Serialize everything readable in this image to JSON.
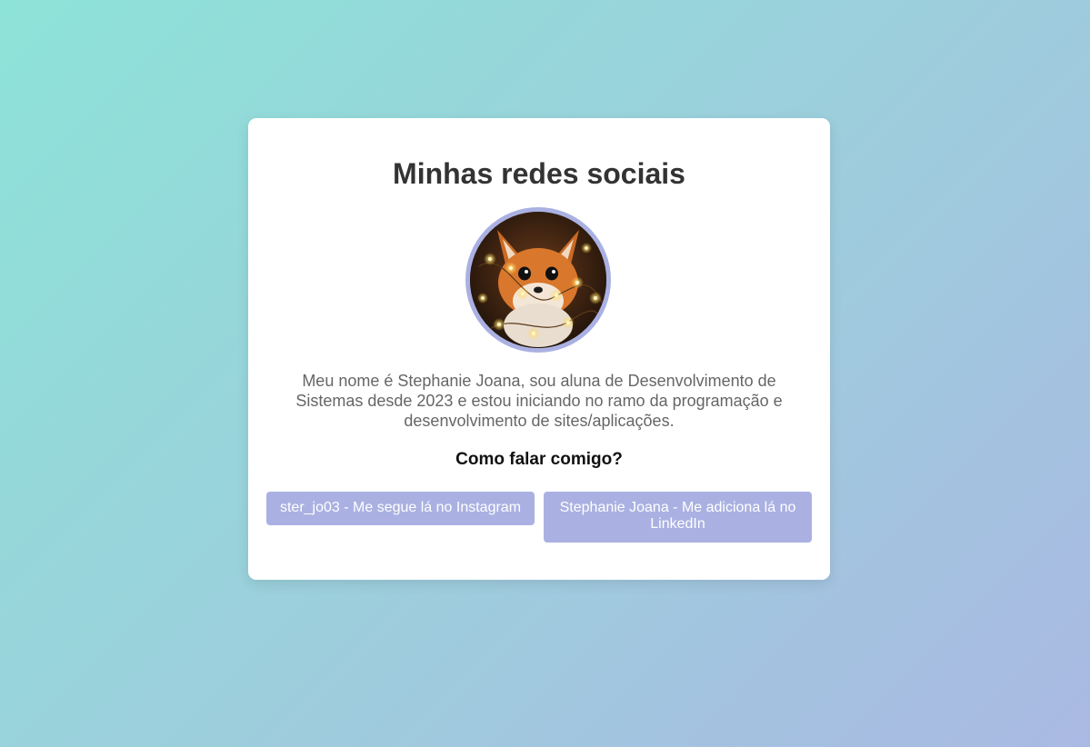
{
  "page": {
    "title": "Minhas redes sociais",
    "bio": "Meu nome é Stephanie Joana, sou aluna de Desenvolvimento de Sistemas desde 2023 e estou iniciando no ramo da programação e desenvolvimento de sites/aplicações.",
    "contact_heading": "Como falar comigo?"
  },
  "avatar": {
    "icon": "fox-avatar"
  },
  "links": {
    "instagram_label": "ster_jo03 - Me segue lá no Instagram",
    "linkedin_label": "Stephanie Joana - Me adiciona lá no LinkedIn"
  },
  "colors": {
    "background_start": "#8de3d8",
    "background_end": "#aab9e3",
    "accent": "#aab1e2",
    "card": "#ffffff"
  }
}
